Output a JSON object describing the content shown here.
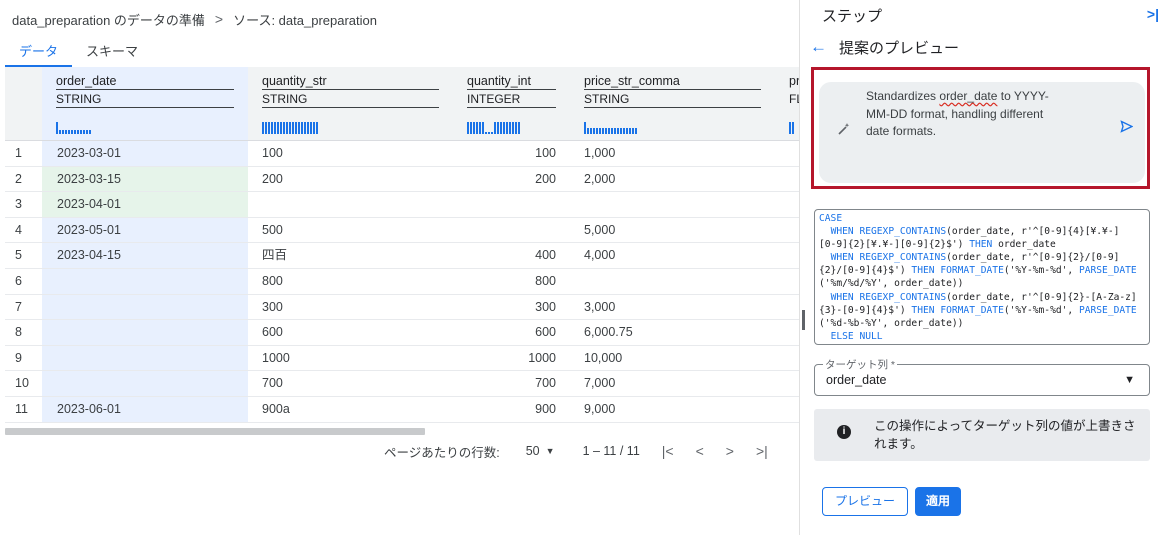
{
  "breadcrumb": {
    "item1": "data_preparation のデータの準備",
    "separator": ">",
    "item2": "ソース: data_preparation"
  },
  "tabs": [
    {
      "label": "データ",
      "active": true
    },
    {
      "label": "スキーマ",
      "active": false
    }
  ],
  "columns": [
    {
      "name": "order_date",
      "type": "STRING"
    },
    {
      "name": "quantity_str",
      "type": "STRING"
    },
    {
      "name": "quantity_int",
      "type": "INTEGER"
    },
    {
      "name": "price_str_comma",
      "type": "STRING"
    },
    {
      "name": "pr",
      "type": "FL"
    }
  ],
  "rows": [
    {
      "idx": "1",
      "order_date": "2023-03-01",
      "quantity_str": "100",
      "quantity_int": "100",
      "price_str_comma": "1,000"
    },
    {
      "idx": "2",
      "order_date": "2023-03-15",
      "quantity_str": "200",
      "quantity_int": "200",
      "price_str_comma": "2,000"
    },
    {
      "idx": "3",
      "order_date": "2023-04-01",
      "quantity_str": "",
      "quantity_int": "",
      "price_str_comma": ""
    },
    {
      "idx": "4",
      "order_date": "2023-05-01",
      "quantity_str": "500",
      "quantity_int": "",
      "price_str_comma": "5,000"
    },
    {
      "idx": "5",
      "order_date": "2023-04-15",
      "quantity_str": "四百",
      "quantity_int": "400",
      "price_str_comma": "4,000"
    },
    {
      "idx": "6",
      "order_date": "",
      "quantity_str": "800",
      "quantity_int": "800",
      "price_str_comma": ""
    },
    {
      "idx": "7",
      "order_date": "",
      "quantity_str": "300",
      "quantity_int": "300",
      "price_str_comma": "3,000"
    },
    {
      "idx": "8",
      "order_date": "",
      "quantity_str": "600",
      "quantity_int": "600",
      "price_str_comma": "6,000.75"
    },
    {
      "idx": "9",
      "order_date": "",
      "quantity_str": "1000",
      "quantity_int": "1000",
      "price_str_comma": "10,000"
    },
    {
      "idx": "10",
      "order_date": "",
      "quantity_str": "700",
      "quantity_int": "700",
      "price_str_comma": "7,000"
    },
    {
      "idx": "11",
      "order_date": "2023-06-01",
      "quantity_str": "900a",
      "quantity_int": "900",
      "price_str_comma": "9,000"
    }
  ],
  "pager": {
    "rows_per_page_label": "ページあたりの行数:",
    "rows_per_page_value": "50",
    "range": "1 – 11 / 11",
    "first": "|<",
    "prev": "<",
    "next": ">",
    "last": ">|"
  },
  "panel": {
    "title": "ステップ",
    "collapse_icon": ">|",
    "subtitle": "提案のプレビュー",
    "suggestion": {
      "text_before": "Standardizes ",
      "text_highlight": "order_date",
      "text_after": " to YYYY-MM-DD format, handling different date formats."
    },
    "code_lines": [
      "CASE",
      "  WHEN REGEXP_CONTAINS(order_date, r'^[0-9]{4}[¥.¥-]",
      "[0-9]{2}[¥.¥-][0-9]{2}$') THEN order_date",
      "  WHEN REGEXP_CONTAINS(order_date, r'^[0-9]{2}/[0-9]",
      "{2}/[0-9]{4}$') THEN FORMAT_DATE('%Y-%m-%d', PARSE_DATE",
      "('%m/%d/%Y', order_date))",
      "  WHEN REGEXP_CONTAINS(order_date, r'^[0-9]{2}-[A-Za-z]",
      "{3}-[0-9]{4}$') THEN FORMAT_DATE('%Y-%m-%d', PARSE_DATE",
      "('%d-%b-%Y', order_date))",
      "  ELSE NULL"
    ],
    "target_label": "ターゲット列 *",
    "target_value": "order_date",
    "info_text": "この操作によってターゲット列の値が上書きされます。",
    "preview_button": "プレビュー",
    "apply_button": "適用"
  },
  "colors": {
    "accent": "#1a73e8",
    "highlight_border": "#b5162b",
    "selected_column": "#e8f0fe",
    "changed_cell": "#e6f4ea"
  }
}
